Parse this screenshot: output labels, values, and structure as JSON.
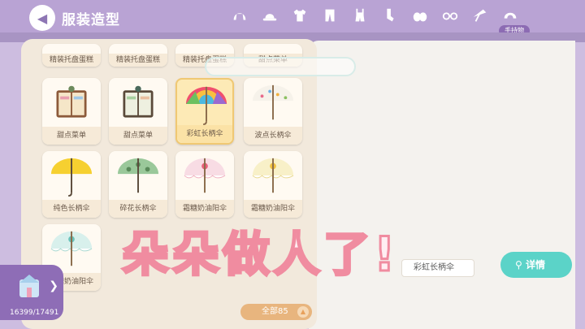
{
  "header": {
    "title": "服装造型"
  },
  "categories": [
    {
      "icon": "hair-icon"
    },
    {
      "icon": "hat-icon"
    },
    {
      "icon": "top-icon"
    },
    {
      "icon": "pants-icon"
    },
    {
      "icon": "overalls-icon"
    },
    {
      "icon": "socks-icon"
    },
    {
      "icon": "shoes-icon"
    },
    {
      "icon": "glasses-icon"
    },
    {
      "icon": "handheld-icon",
      "active": true,
      "label": "手持物"
    },
    {
      "icon": "more-icon"
    }
  ],
  "active_category_label": "手持物",
  "items": {
    "row0": [
      "精装托盘蛋糕",
      "精装托盘蛋糕",
      "精装托盘蛋糕",
      "甜点菜单"
    ],
    "row1": [
      "甜点菜单",
      "甜点菜单",
      "彩虹长柄伞",
      "波点长柄伞"
    ],
    "row2": [
      "纯色长柄伞",
      "碎花长柄伞",
      "霜糖奶油阳伞",
      "霜糖奶油阳伞"
    ],
    "row3": [
      "霜糖奶油阳伞"
    ]
  },
  "selected_item": "彩虹长柄伞",
  "filter": {
    "label": "全部85"
  },
  "overlay_text": "朵朵做人了!",
  "preview": {
    "item_name": "彩虹长柄伞",
    "detail_button": "详情"
  },
  "wardrobe": {
    "count": "16399/17491"
  },
  "colors": {
    "accent": "#8c6bb3",
    "detail_button": "#5bd3c8",
    "filter_pill": "#e8b57e",
    "overlay_stroke": "#f08ca0"
  }
}
